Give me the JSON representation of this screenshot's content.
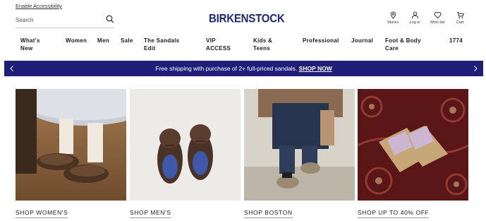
{
  "header": {
    "accessibility_link": "Enable Accessibility",
    "search_placeholder": "Search",
    "logo_text": "BIRKENSTOCK",
    "utilities": [
      {
        "label": "Stores",
        "icon": "location-pin-icon"
      },
      {
        "label": "Log in",
        "icon": "user-icon"
      },
      {
        "label": "Wish list",
        "icon": "heart-icon"
      },
      {
        "label": "Cart",
        "icon": "cart-icon"
      }
    ]
  },
  "nav": {
    "items": [
      {
        "line1": "What's",
        "line2": "New"
      },
      {
        "line1": "Women",
        "line2": ""
      },
      {
        "line1": "Men",
        "line2": ""
      },
      {
        "line1": "Sale",
        "line2": ""
      },
      {
        "line1": "The Sandals",
        "line2": "Edit"
      },
      {
        "line1": "VIP",
        "line2": "ACCESS"
      },
      {
        "line1": "Kids &",
        "line2": "Teens"
      },
      {
        "line1": "Professional",
        "line2": ""
      },
      {
        "line1": "Journal",
        "line2": ""
      },
      {
        "line1": "Foot & Body",
        "line2": "Care"
      },
      {
        "line1": "1774",
        "line2": ""
      }
    ]
  },
  "promo": {
    "text": "Free shipping with purchase of 2+ full-priced sandals.",
    "cta": "SHOP NOW",
    "prev_icon": "chevron-left-icon",
    "next_icon": "chevron-right-icon",
    "background": "#1f1f7a"
  },
  "tiles": [
    {
      "label": "SHOP WOMEN'S",
      "image": "women-clogs-photo"
    },
    {
      "label": "SHOP MEN'S",
      "image": "men-shoes-photo"
    },
    {
      "label": "SHOP BOSTON",
      "image": "boston-clogs-photo"
    },
    {
      "label": "SHOP UP TO 40% OFF",
      "image": "sale-sandals-photo"
    }
  ],
  "colors": {
    "brand": "#1d2a6b",
    "promo_bar": "#1f1f7a"
  }
}
